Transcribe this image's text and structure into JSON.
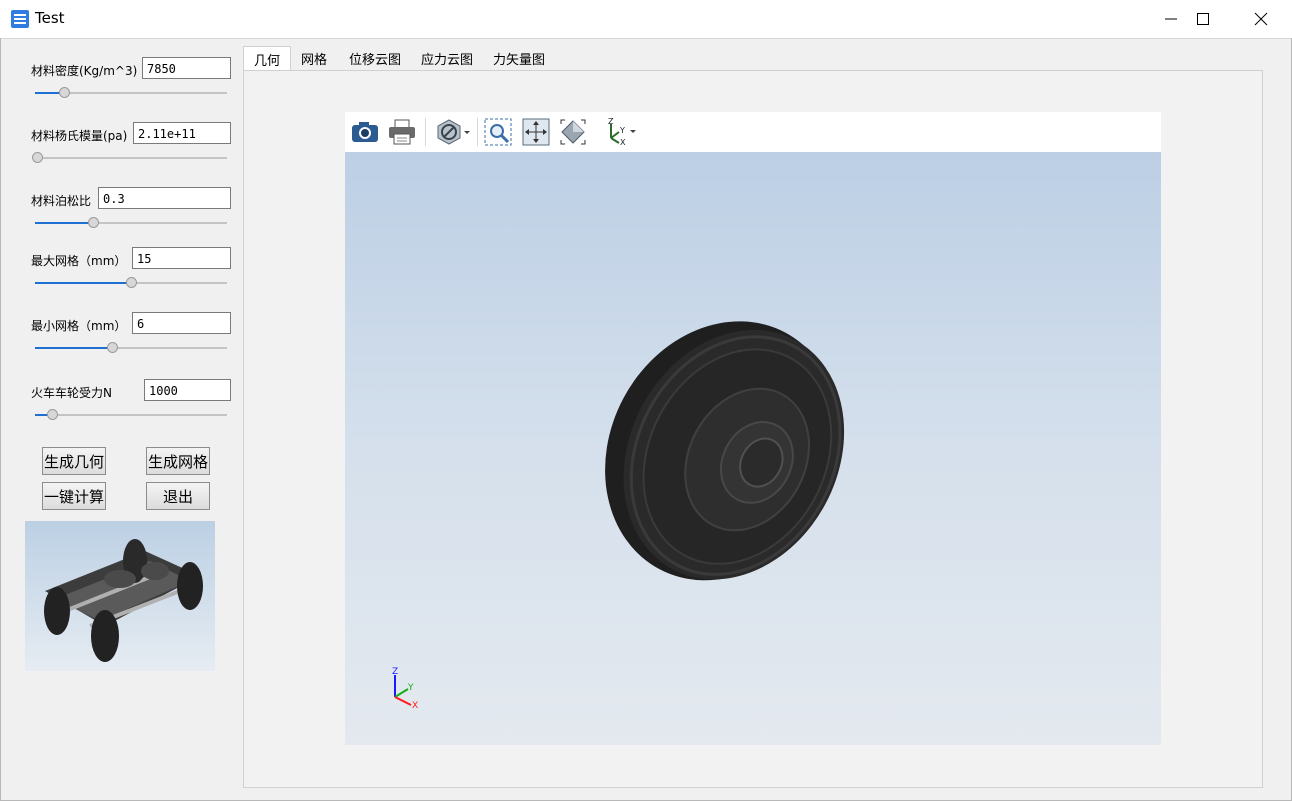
{
  "window": {
    "title": "Test",
    "minimize_icon": "minimize-icon",
    "maximize_icon": "maximize-icon",
    "close_icon": "close-icon"
  },
  "params": [
    {
      "label": "材料密度(Kg/m^3)",
      "value": "7850",
      "slider": 0.15
    },
    {
      "label": "材料杨氏模量(pa)",
      "value": "2.11e+11",
      "slider": 0.0
    },
    {
      "label": "材料泊松比",
      "value": "0.3",
      "slider": 0.3
    },
    {
      "label": "最大网格（mm）",
      "value": "15",
      "slider": 0.5
    },
    {
      "label": "最小网格（mm）",
      "value": "6",
      "slider": 0.4
    },
    {
      "label": "火车车轮受力N",
      "value": "1000",
      "slider": 0.09
    }
  ],
  "buttons": {
    "gen_geometry": "生成几何",
    "gen_mesh": "生成网格",
    "compute": "一键计算",
    "exit": "退出"
  },
  "tabs": [
    {
      "label": "几何",
      "active": true
    },
    {
      "label": "网格",
      "active": false
    },
    {
      "label": "位移云图",
      "active": false
    },
    {
      "label": "应力云图",
      "active": false
    },
    {
      "label": "力矢量图",
      "active": false
    }
  ],
  "toolbar": [
    {
      "icon": "camera-icon"
    },
    {
      "icon": "print-icon"
    },
    {
      "icon": "display-mode-icon"
    },
    {
      "icon": "zoom-window-icon"
    },
    {
      "icon": "pan-icon"
    },
    {
      "icon": "fit-all-icon"
    },
    {
      "icon": "axes-view-icon"
    }
  ],
  "axes": {
    "x": "X",
    "y": "Y",
    "z": "Z"
  },
  "colors": {
    "slider_fill": "#1e6fd0",
    "viewport_top": "#bccfe5",
    "viewport_bottom": "#e4e9ef"
  }
}
